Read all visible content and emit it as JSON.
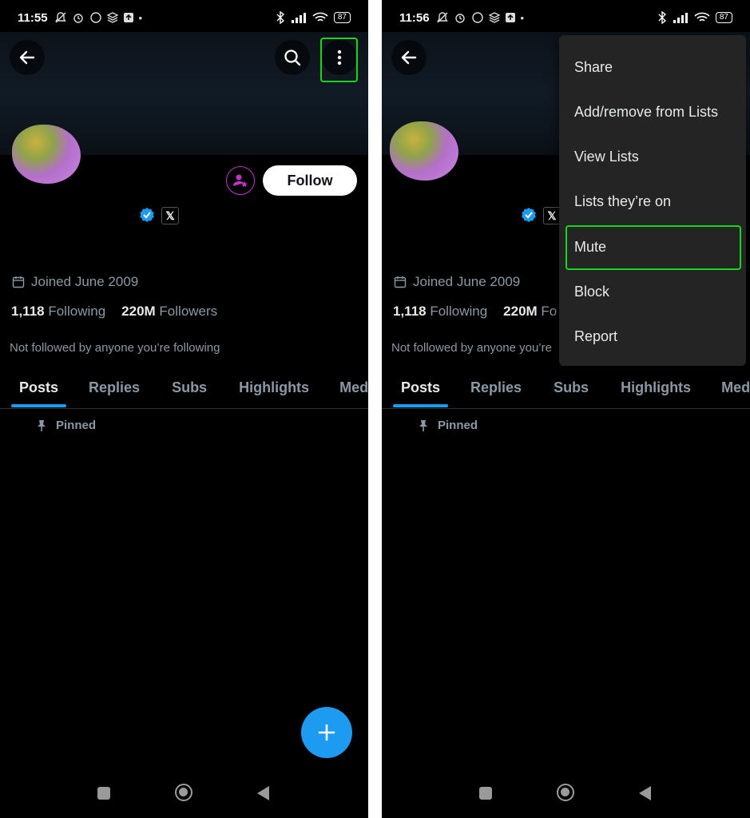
{
  "left_screen": {
    "status": {
      "time": "11:55",
      "battery": "87"
    },
    "follow_label": "Follow",
    "joined": "Joined June 2009",
    "following_count": "1,118",
    "following_label": "Following",
    "followers_count": "220M",
    "followers_label": "Followers",
    "not_followed": "Not followed by anyone you’re following",
    "tabs": [
      "Posts",
      "Replies",
      "Subs",
      "Highlights",
      "Media"
    ],
    "pinned": "Pinned",
    "x_badge": "𝕏"
  },
  "right_screen": {
    "status": {
      "time": "11:56",
      "battery": "87"
    },
    "joined": "Joined June 2009",
    "following_count": "1,118",
    "following_label": "Following",
    "followers_count": "220M",
    "followers_label": "Fo",
    "not_followed": "Not followed by anyone you’re",
    "tabs": [
      "Posts",
      "Replies",
      "Subs",
      "Highlights",
      "Media"
    ],
    "pinned": "Pinned",
    "x_badge": "𝕏",
    "menu": [
      "Share",
      "Add/remove from Lists",
      "View Lists",
      "Lists they’re on",
      "Mute",
      "Block",
      "Report"
    ]
  },
  "colors": {
    "accent": "#1d9bf0",
    "highlight_box": "#19d619",
    "subscribe_ring": "#c235c8",
    "background": "#000000",
    "menu_bg": "#242424"
  },
  "icons": [
    "back-arrow-icon",
    "search-icon",
    "more-vertical-icon",
    "subscribe-user-star-icon",
    "verified-badge-icon",
    "calendar-icon",
    "pin-icon",
    "plus-icon",
    "nav-recents-icon",
    "nav-home-icon",
    "nav-back-icon"
  ]
}
